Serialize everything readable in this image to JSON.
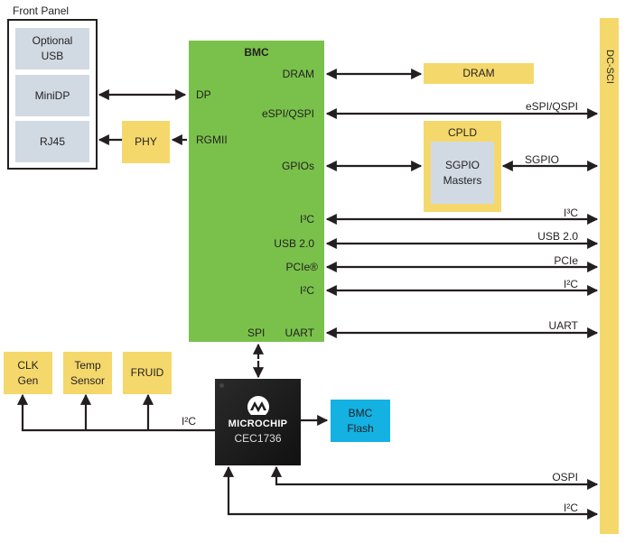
{
  "front_panel": {
    "title": "Front Panel",
    "items": [
      "Optional\nUSB",
      "MiniDP",
      "RJ45"
    ]
  },
  "phy": {
    "label": "PHY"
  },
  "bmc": {
    "title": "BMC",
    "left_ports": {
      "dp": "DP",
      "rgmii": "RGMII"
    },
    "right_ports": {
      "dram": "DRAM",
      "espi": "eSPI/QSPI",
      "gpios": "GPIOs",
      "i3c": "I³C",
      "usb": "USB 2.0",
      "pcie": "PCIe®",
      "i2c": "I²C",
      "uart": "UART"
    },
    "bottom_ports": {
      "spi": "SPI"
    }
  },
  "dram": {
    "label": "DRAM"
  },
  "cpld": {
    "title": "CPLD",
    "inner": "SGPIO\nMasters"
  },
  "dcsci": {
    "label": "DC-SCI"
  },
  "bus_labels": {
    "espi": "eSPI/QSPI",
    "sgpio": "SGPIO",
    "i3c": "I³C",
    "usb": "USB 2.0",
    "pcie": "PCIe",
    "i2c": "I²C",
    "uart": "UART",
    "ospi": "OSPI",
    "i2c_bottom": "I²C",
    "i2c_left": "I²C"
  },
  "peripherals": [
    "CLK\nGen",
    "Temp\nSensor",
    "FRUID"
  ],
  "chip": {
    "brand": "MICROCHIP",
    "part": "CEC1736",
    "logo_icon": "microchip-logo-icon"
  },
  "bmc_flash": {
    "label": "BMC\nFlash"
  },
  "colors": {
    "bmc_green": "#79c14b",
    "yellow": "#f5d86b",
    "grey": "#d1dae3",
    "flash_cyan": "#14b1e3",
    "chip_black": "#1a1a1a"
  }
}
